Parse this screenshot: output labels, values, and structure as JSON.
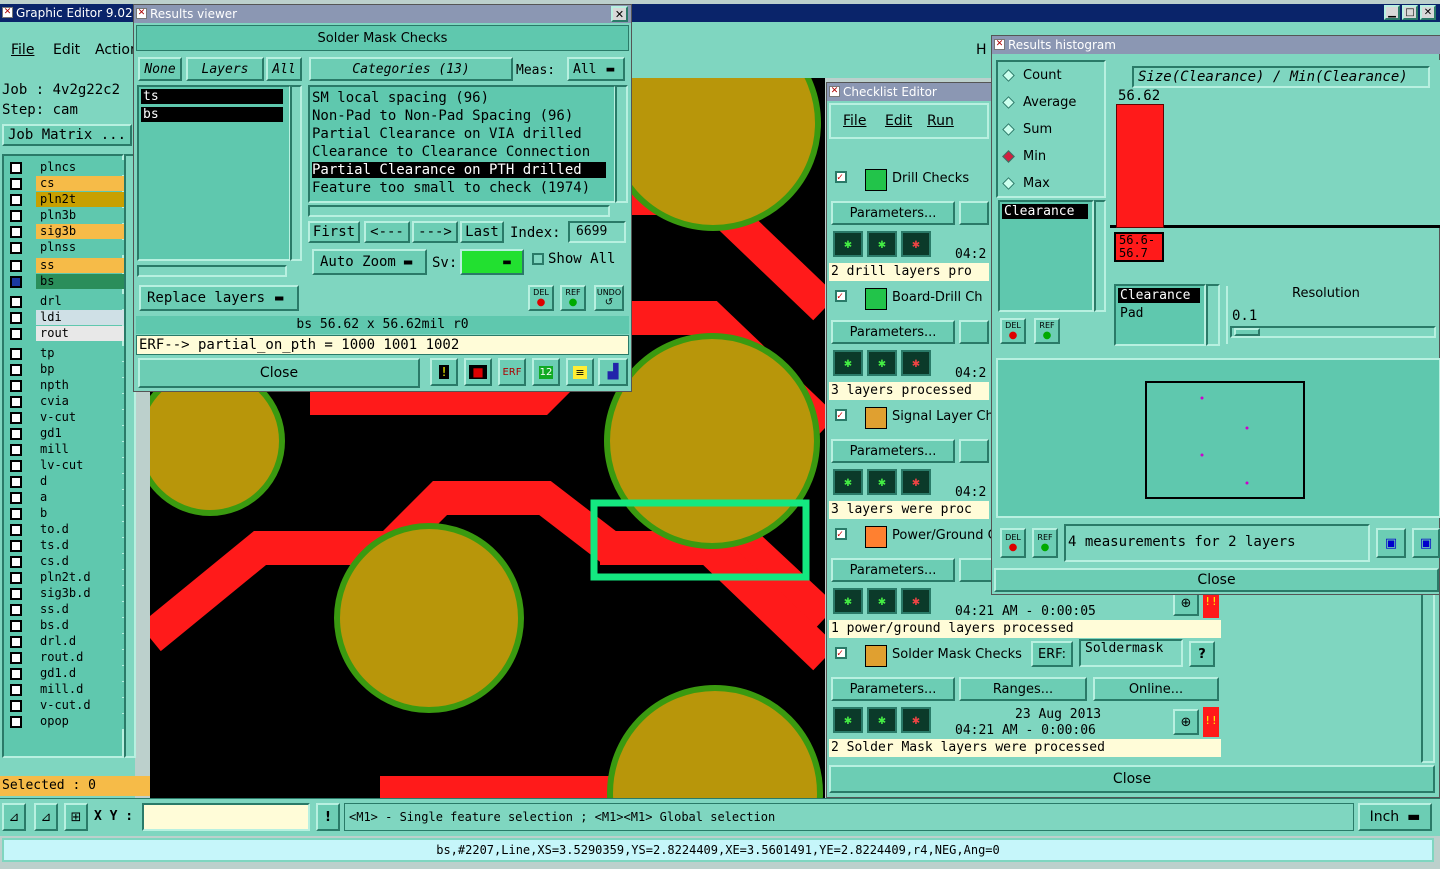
{
  "main_window": {
    "title": "Graphic Editor 9.02c2",
    "menu": [
      "File",
      "Edit",
      "Action"
    ],
    "job_label": "Job :",
    "job_value": "4v2g22c2",
    "step_label": "Step:",
    "step_value": "cam",
    "job_matrix": "Job Matrix ...",
    "partial_menu": "H",
    "selected": "Selected : 0"
  },
  "layers": [
    {
      "name": "plncs",
      "color": "#5fc8ae",
      "checked": false
    },
    {
      "name": "cs",
      "color": "#f6bb48",
      "checked": false
    },
    {
      "name": "pln2t",
      "color": "#c8a000",
      "checked": false
    },
    {
      "name": "pln3b",
      "color": "#5fc8ae",
      "checked": false
    },
    {
      "name": "sig3b",
      "color": "#f6bb48",
      "checked": false
    },
    {
      "name": "plnss",
      "color": "#5fc8ae",
      "checked": false
    },
    {
      "name": "ss",
      "color": "#f6bb48",
      "checked": false
    },
    {
      "name": "bs",
      "color": "#2a8e5a",
      "checked": true
    },
    {
      "name": "drl",
      "color": "#5fc8ae",
      "checked": false
    },
    {
      "name": "ldi",
      "color": "#cfe0e6",
      "checked": false
    },
    {
      "name": "rout",
      "color": "#e8e8e8",
      "checked": false
    },
    {
      "name": "tp",
      "color": "#5fc8ae",
      "checked": false
    },
    {
      "name": "bp",
      "color": "#5fc8ae",
      "checked": false
    },
    {
      "name": "npth",
      "color": "#5fc8ae",
      "checked": false
    },
    {
      "name": "cvia",
      "color": "#5fc8ae",
      "checked": false
    },
    {
      "name": "v-cut",
      "color": "#5fc8ae",
      "checked": false
    },
    {
      "name": "gd1",
      "color": "#5fc8ae",
      "checked": false
    },
    {
      "name": "mill",
      "color": "#5fc8ae",
      "checked": false
    },
    {
      "name": "lv-cut",
      "color": "#5fc8ae",
      "checked": false
    },
    {
      "name": "d",
      "color": "#5fc8ae",
      "checked": false
    },
    {
      "name": "a",
      "color": "#5fc8ae",
      "checked": false
    },
    {
      "name": "b",
      "color": "#5fc8ae",
      "checked": false
    },
    {
      "name": "to.d",
      "color": "#5fc8ae",
      "checked": false
    },
    {
      "name": "ts.d",
      "color": "#5fc8ae",
      "checked": false
    },
    {
      "name": "cs.d",
      "color": "#5fc8ae",
      "checked": false
    },
    {
      "name": "pln2t.d",
      "color": "#5fc8ae",
      "checked": false
    },
    {
      "name": "sig3b.d",
      "color": "#5fc8ae",
      "checked": false
    },
    {
      "name": "ss.d",
      "color": "#5fc8ae",
      "checked": false
    },
    {
      "name": "bs.d",
      "color": "#5fc8ae",
      "checked": false
    },
    {
      "name": "drl.d",
      "color": "#5fc8ae",
      "checked": false
    },
    {
      "name": "rout.d",
      "color": "#5fc8ae",
      "checked": false
    },
    {
      "name": "gd1.d",
      "color": "#5fc8ae",
      "checked": false
    },
    {
      "name": "mill.d",
      "color": "#5fc8ae",
      "checked": false
    },
    {
      "name": "v-cut.d",
      "color": "#5fc8ae",
      "checked": false
    },
    {
      "name": "opop",
      "color": "#5fc8ae",
      "checked": false
    }
  ],
  "results_viewer": {
    "title": "Results viewer",
    "header": "Solder Mask Checks",
    "none_btn": "None",
    "layers_btn": "Layers",
    "all_btn": "All",
    "categories_btn": "Categories (13)",
    "meas_label": "Meas:",
    "meas_value": "All",
    "layer_list": [
      "ts",
      "bs"
    ],
    "categories": [
      "SM local spacing (96)",
      "Non-Pad to Non-Pad Spacing (96)",
      "Partial Clearance on VIA drilled",
      "Clearance to Clearance Connection",
      "Partial Clearance on PTH drilled",
      "Feature too small to check (1974)"
    ],
    "first": "First",
    "prev": "<---",
    "next": "--->",
    "last": "Last",
    "index_label": "Index:",
    "index_value": "6699",
    "zoom": "Auto Zoom",
    "sv_label": "Sv:",
    "show_all": "Show All",
    "replace": "Replace layers",
    "del": "DEL",
    "ref": "REF",
    "undo": "UNDO",
    "status": "bs 56.62 x 56.62mil  r0",
    "erf": "ERF--> partial_on_pth = 1000 1001 1002",
    "close": "Close"
  },
  "checklist": {
    "title": "Checklist Editor",
    "menu": [
      "File",
      "Edit",
      "Run"
    ],
    "checks": [
      {
        "name": "Drill Checks",
        "time": "04:2",
        "status": "2 drill layers pro"
      },
      {
        "name": "Board-Drill Ch",
        "time": "04:2",
        "status": "3 layers processed"
      },
      {
        "name": "Signal Layer Ch",
        "time": "04:2",
        "status": "3 layers were proc"
      },
      {
        "name": "Power/Ground C",
        "time": "04:21 AM - 0:00:05",
        "status": "1 power/ground layers processed"
      },
      {
        "name": "Solder Mask Checks",
        "time": "04:21 AM - 0:00:06",
        "date": "23 Aug 2013",
        "status": "2 Solder Mask layers were processed"
      }
    ],
    "parameters": "Parameters...",
    "ranges": "Ranges...",
    "online": "Online...",
    "erf_label": "ERF:",
    "erf_value": "Soldermask",
    "help": "?",
    "close": "Close",
    "alert": "!!"
  },
  "histogram": {
    "title": "Results histogram",
    "options": [
      "Count",
      "Average",
      "Sum",
      "Min",
      "Max"
    ],
    "selected": "Min",
    "formula": "Size(Clearance) / Min(Clearance)",
    "bar_value": "56.62",
    "range_label": "56.6-\n56.7",
    "list_item": "Clearance",
    "list2": [
      "Clearance",
      "Pad"
    ],
    "resolution_label": "Resolution",
    "resolution_value": "0.1",
    "del": "DEL",
    "ref": "REF",
    "measurements": "4 measurements for 2 layers",
    "close": "Close"
  },
  "bottom": {
    "xy_label": "X Y :",
    "hint": "<M1> - Single feature selection ; <M1><M1> Global selection",
    "units": "Inch",
    "status": "bs,#2207,Line,XS=3.5290359,YS=2.8224409,XE=3.5601491,YE=2.8224409,r4,NEG,Ang=0",
    "partial_text": "Partial Clearance"
  }
}
